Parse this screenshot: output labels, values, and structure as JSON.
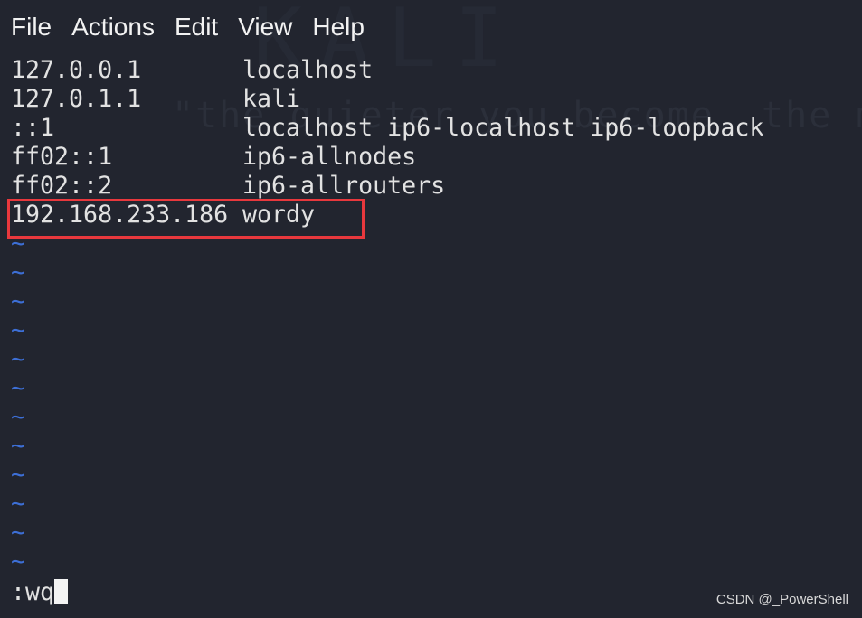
{
  "menu": [
    "File",
    "Actions",
    "Edit",
    "View",
    "Help"
  ],
  "background_watermark": {
    "big": "KALI LINUX",
    "slogan": "\"the quieter you become, the m"
  },
  "hosts": [
    {
      "ip": "127.0.0.1",
      "names": "localhost"
    },
    {
      "ip": "127.0.1.1",
      "names": "kali"
    },
    {
      "ip": "::1",
      "names": "localhost ip6-localhost ip6-loopback"
    },
    {
      "ip": "ff02::1",
      "names": "ip6-allnodes"
    },
    {
      "ip": "ff02::2",
      "names": "ip6-allrouters"
    },
    {
      "ip": "192.168.233.186",
      "names": "wordy"
    }
  ],
  "empty_line_marker": "~",
  "command": ":wq",
  "csdn_watermark": "CSDN @_PowerShell",
  "colors": {
    "background": "#22252f",
    "tilde": "#3d6fd6",
    "highlight_box": "#e8383d"
  }
}
